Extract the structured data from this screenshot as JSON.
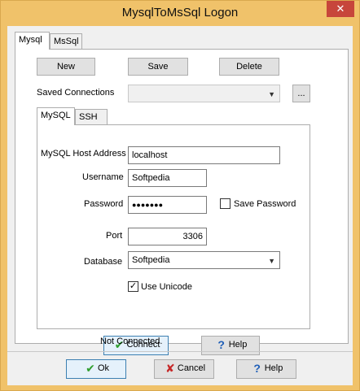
{
  "window": {
    "title": "MysqlToMsSql Logon",
    "close_glyph": "✕"
  },
  "outer_tabs": [
    {
      "label": "Mysql"
    },
    {
      "label": "MsSql"
    }
  ],
  "toolbar": {
    "new_label": "New",
    "save_label": "Save",
    "delete_label": "Delete"
  },
  "saved_connections": {
    "label": "Saved Connections",
    "value": "",
    "browse_label": "..."
  },
  "inner_tabs": [
    {
      "label": "MySQL"
    },
    {
      "label": "SSH"
    }
  ],
  "form": {
    "host_label": "MySQL Host Address",
    "host_value": "localhost",
    "username_label": "Username",
    "username_value": "Softpedia",
    "password_label": "Password",
    "password_value": "●●●●●●●",
    "save_password_label": "Save Password",
    "save_password_checked": false,
    "port_label": "Port",
    "port_value": "3306",
    "database_label": "Database",
    "database_value": "Softpedia",
    "unicode_label": "Use Unicode",
    "unicode_checked": true
  },
  "connection": {
    "connect_label": "Connect",
    "help_label": "Help",
    "status": "Not Connected."
  },
  "footer": {
    "ok_label": "Ok",
    "cancel_label": "Cancel",
    "help_label": "Help"
  },
  "colors": {
    "titlebar": "#f0c26a",
    "close": "#c7463b",
    "ok_green": "#2f9e2f",
    "cancel_red": "#c62828",
    "help_blue": "#1f5fb8"
  }
}
